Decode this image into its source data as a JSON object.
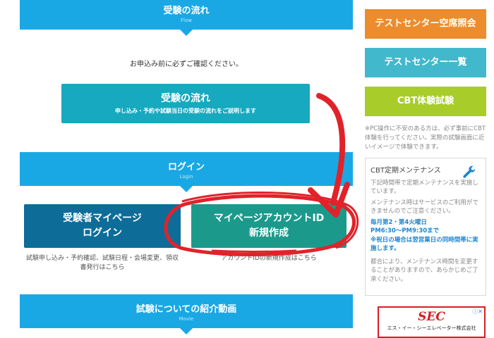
{
  "main": {
    "flow_banner": {
      "title": "受験の流れ",
      "sub": "Flow"
    },
    "flow_note": "お申込み前に必ずご確認ください。",
    "flow_button": {
      "title": "受験の流れ",
      "sub": "申し込み・予約や試験当日の受験の流れをご説明します"
    },
    "login_banner": {
      "title": "ログイン",
      "sub": "Login"
    },
    "mypage_button": {
      "line1": "受験者マイページ",
      "line2": "ログイン"
    },
    "mypage_caption": "試験申し込み・予約確認、試験日程・会場変更、領収書発行はこちら",
    "newacct_button": {
      "line1": "マイページアカウントID",
      "line2": "新規作成"
    },
    "newacct_caption": "アカウントIDの新規作成はこちら",
    "movie_banner": {
      "title": "試験についての紹介動画",
      "sub": "Movie"
    }
  },
  "sidebar": {
    "vacancy": "テストセンター空席照会",
    "centers": "テストセンター一覧",
    "cbt": "CBT体験試験",
    "cbt_note": "※PC操作に不安のある方は、必ず事前にCBT体験を行ってください。実際の試験画面に近いイメージで体験できます。",
    "maintenance": {
      "title": "CBT定期メンテナンス",
      "p1": "下記時間帯で定期メンテナンスを実施しています。",
      "p2": "メンテナンス時はサービスのご利用ができませんのでご注意ください。",
      "h1": "毎月第2・第4火曜日",
      "h2": "PM6:30～PM9:30まで",
      "h3": "※祝日の場合は翌営業日の同時間帯に実施します。",
      "p3": "都合により、メンテナンス時間を変更することがありますので、あらかじめご了承ください。"
    },
    "ad": {
      "logo": "SEC",
      "company": "エス・イー・シーエレベーター株式会社"
    }
  },
  "colors": {
    "banner": "#1aa8e4",
    "flow_button": "#17a9bf",
    "mypage_button": "#0d6d98",
    "newacct_button": "#1b9a8c",
    "vacancy": "#ec8c2c",
    "centers": "#42b8cd",
    "cbt": "#a8cc2a",
    "annotation": "#e0232a"
  },
  "icons": {
    "maintenance": "wrench-icon",
    "ad_choices": "adchoices-icon"
  }
}
